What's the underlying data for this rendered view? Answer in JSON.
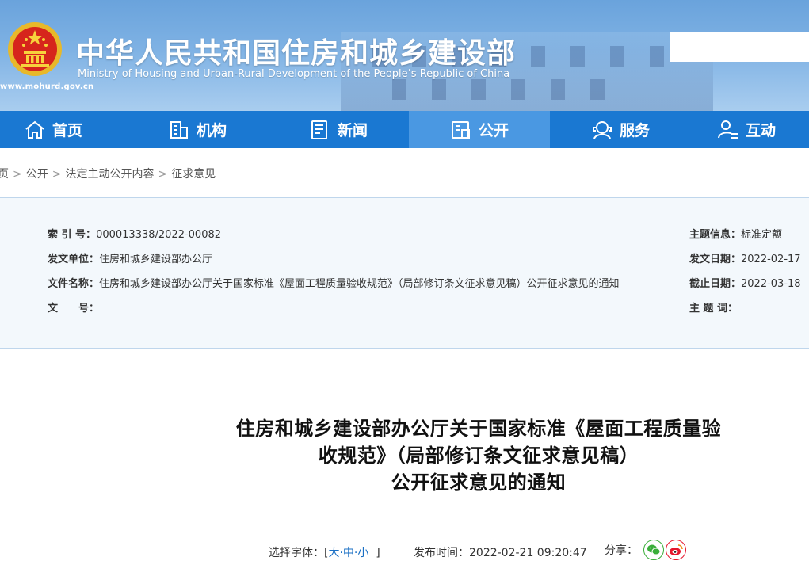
{
  "header": {
    "title_cn": "中华人民共和国住房和城乡建设部",
    "title_en": "Ministry of Housing and Urban-Rural Development of the People’s Republic of China",
    "site_url": "www.mohurd.gov.cn",
    "search_placeholder": ""
  },
  "nav": {
    "items": [
      {
        "label": "首页",
        "icon": "home-icon"
      },
      {
        "label": "机构",
        "icon": "building-icon"
      },
      {
        "label": "新闻",
        "icon": "news-icon"
      },
      {
        "label": "公开",
        "icon": "disclosure-icon",
        "active": true
      },
      {
        "label": "服务",
        "icon": "service-icon"
      },
      {
        "label": "互动",
        "icon": "interaction-icon"
      }
    ]
  },
  "breadcrumb": {
    "items": [
      "页",
      "公开",
      "法定主动公开内容",
      "征求意见"
    ],
    "separator": ">"
  },
  "info": {
    "index_label": "索 引 号：",
    "index_value": "000013338/2022-00082",
    "issuer_label": "发文单位：",
    "issuer_value": "住房和城乡建设部办公厅",
    "docname_label": "文件名称：",
    "docname_value": "住房和城乡建设部办公厅关于国家标准《屋面工程质量验收规范》（局部修订条文征求意见稿）公开征求意见的通知",
    "docno_label": "文　　号：",
    "docno_value": "",
    "topic_label": "主题信息：",
    "topic_value": "标准定额",
    "issue_date_label": "发文日期：",
    "issue_date_value": "2022-02-17",
    "deadline_label": "截止日期：",
    "deadline_value": "2022-03-18",
    "keywords_label": "主 题 词：",
    "keywords_value": ""
  },
  "article": {
    "title_lines": [
      "住房和城乡建设部办公厅关于国家标准《屋面工程质量验",
      "收规范》（局部修订条文征求意见稿）",
      "公开征求意见的通知"
    ],
    "font_size_label": "选择字体：[",
    "font_large": "大",
    "font_medium": "中",
    "font_small": "小",
    "font_dash": "·",
    "font_close": "]",
    "publish_time_label": "发布时间：",
    "publish_time_value": "2022-02-21 09:20:47",
    "share_label": "分享：",
    "share_icons": [
      "wechat-icon",
      "weibo-icon"
    ]
  },
  "colors": {
    "nav_bg": "#1a78d2",
    "nav_active": "#4a98e2",
    "info_bg": "#f3f8fc",
    "link": "#1a6fc4",
    "wechat": "#3aae3a",
    "weibo": "#e6162d"
  }
}
